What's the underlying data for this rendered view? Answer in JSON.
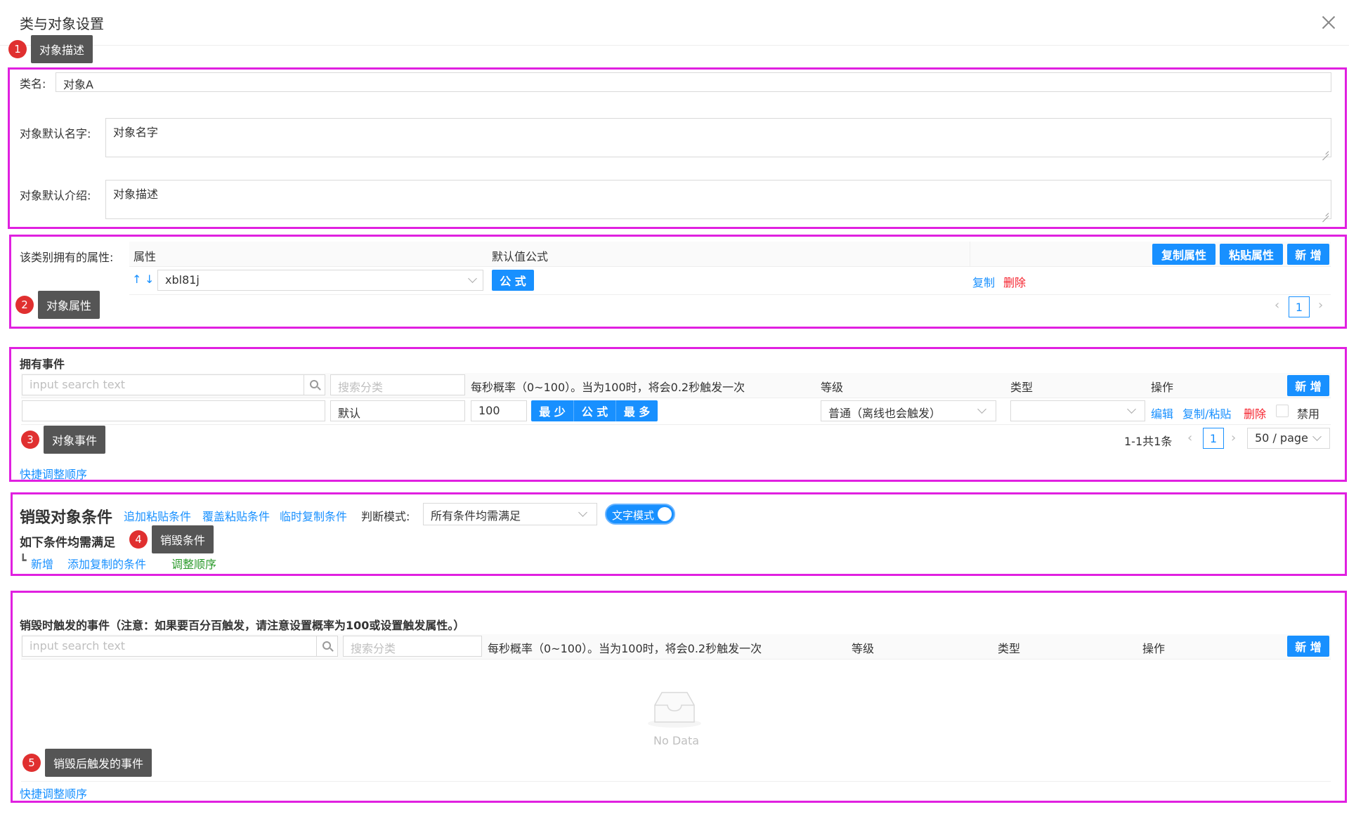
{
  "dialog": {
    "title": "类与对象设置"
  },
  "annotations": [
    {
      "num": "1",
      "label": "对象描述"
    },
    {
      "num": "2",
      "label": "对象属性"
    },
    {
      "num": "3",
      "label": "对象事件"
    },
    {
      "num": "4",
      "label": "销毁条件"
    },
    {
      "num": "5",
      "label": "销毁后触发的事件"
    }
  ],
  "object_desc": {
    "class_name_label": "类名:",
    "class_name_value": "对象A",
    "default_name_label": "对象默认名字:",
    "default_name_value": "对象名字",
    "default_intro_label": "对象默认介绍:",
    "default_intro_value": "对象描述"
  },
  "attributes": {
    "label": "该类别拥有的属性:",
    "columns": [
      "属性",
      "默认值公式"
    ],
    "copy_attr_btn": "复制属性",
    "paste_attr_btn": "粘贴属性",
    "add_btn": "新 增",
    "row": {
      "sort_up": "↑",
      "sort_down": "↓",
      "select_value": "xbl81j",
      "formula_btn": "公 式",
      "copy_link": "复制",
      "delete_link": "删除"
    },
    "page": "1",
    "prev": "‹",
    "next": "›"
  },
  "events": {
    "title": "拥有事件",
    "search_placeholder": "input search text",
    "category_placeholder": "搜索分类",
    "probability_header": "每秒概率（0~100）。当为100时，将会0.2秒触发一次",
    "level_header": "等级",
    "type_header": "类型",
    "ops_header": "操作",
    "add_btn": "新 增",
    "row": {
      "category": "默认",
      "probability": "100",
      "min_btn": "最 少",
      "formula_btn": "公 式",
      "max_btn": "最 多",
      "level": "普通（离线也会触发）",
      "edit": "编辑",
      "copy_paste": "复制/粘贴",
      "delete": "删除",
      "disable": "禁用"
    },
    "total": "1-1共1条",
    "page": "1",
    "page_size": "50 / page",
    "prev": "‹",
    "next": "›",
    "reorder_link": "快捷调整顺序"
  },
  "destroy": {
    "title": "销毁对象条件",
    "append_paste": "追加粘贴条件",
    "overwrite_paste": "覆盖粘贴条件",
    "temp_copy": "临时复制条件",
    "mode_label": "判断模式:",
    "mode_value": "所有条件均需满足",
    "toggle_label": "文字模式",
    "condition_text": "如下条件均需满足",
    "tree_mark": "┗",
    "add_link": "新增",
    "add_copied": "添加复制的条件",
    "reorder": "调整顺序"
  },
  "destroy_events": {
    "title": "销毁时触发的事件（注意：如果要百分百触发，请注意设置概率为100或设置触发属性。）",
    "search_placeholder": "input search text",
    "category_placeholder": "搜索分类",
    "probability_header": "每秒概率（0~100）。当为100时，将会0.2秒触发一次",
    "level_header": "等级",
    "type_header": "类型",
    "ops_header": "操作",
    "add_btn": "新 增",
    "empty_text": "No Data",
    "reorder_link": "快捷调整顺序"
  }
}
